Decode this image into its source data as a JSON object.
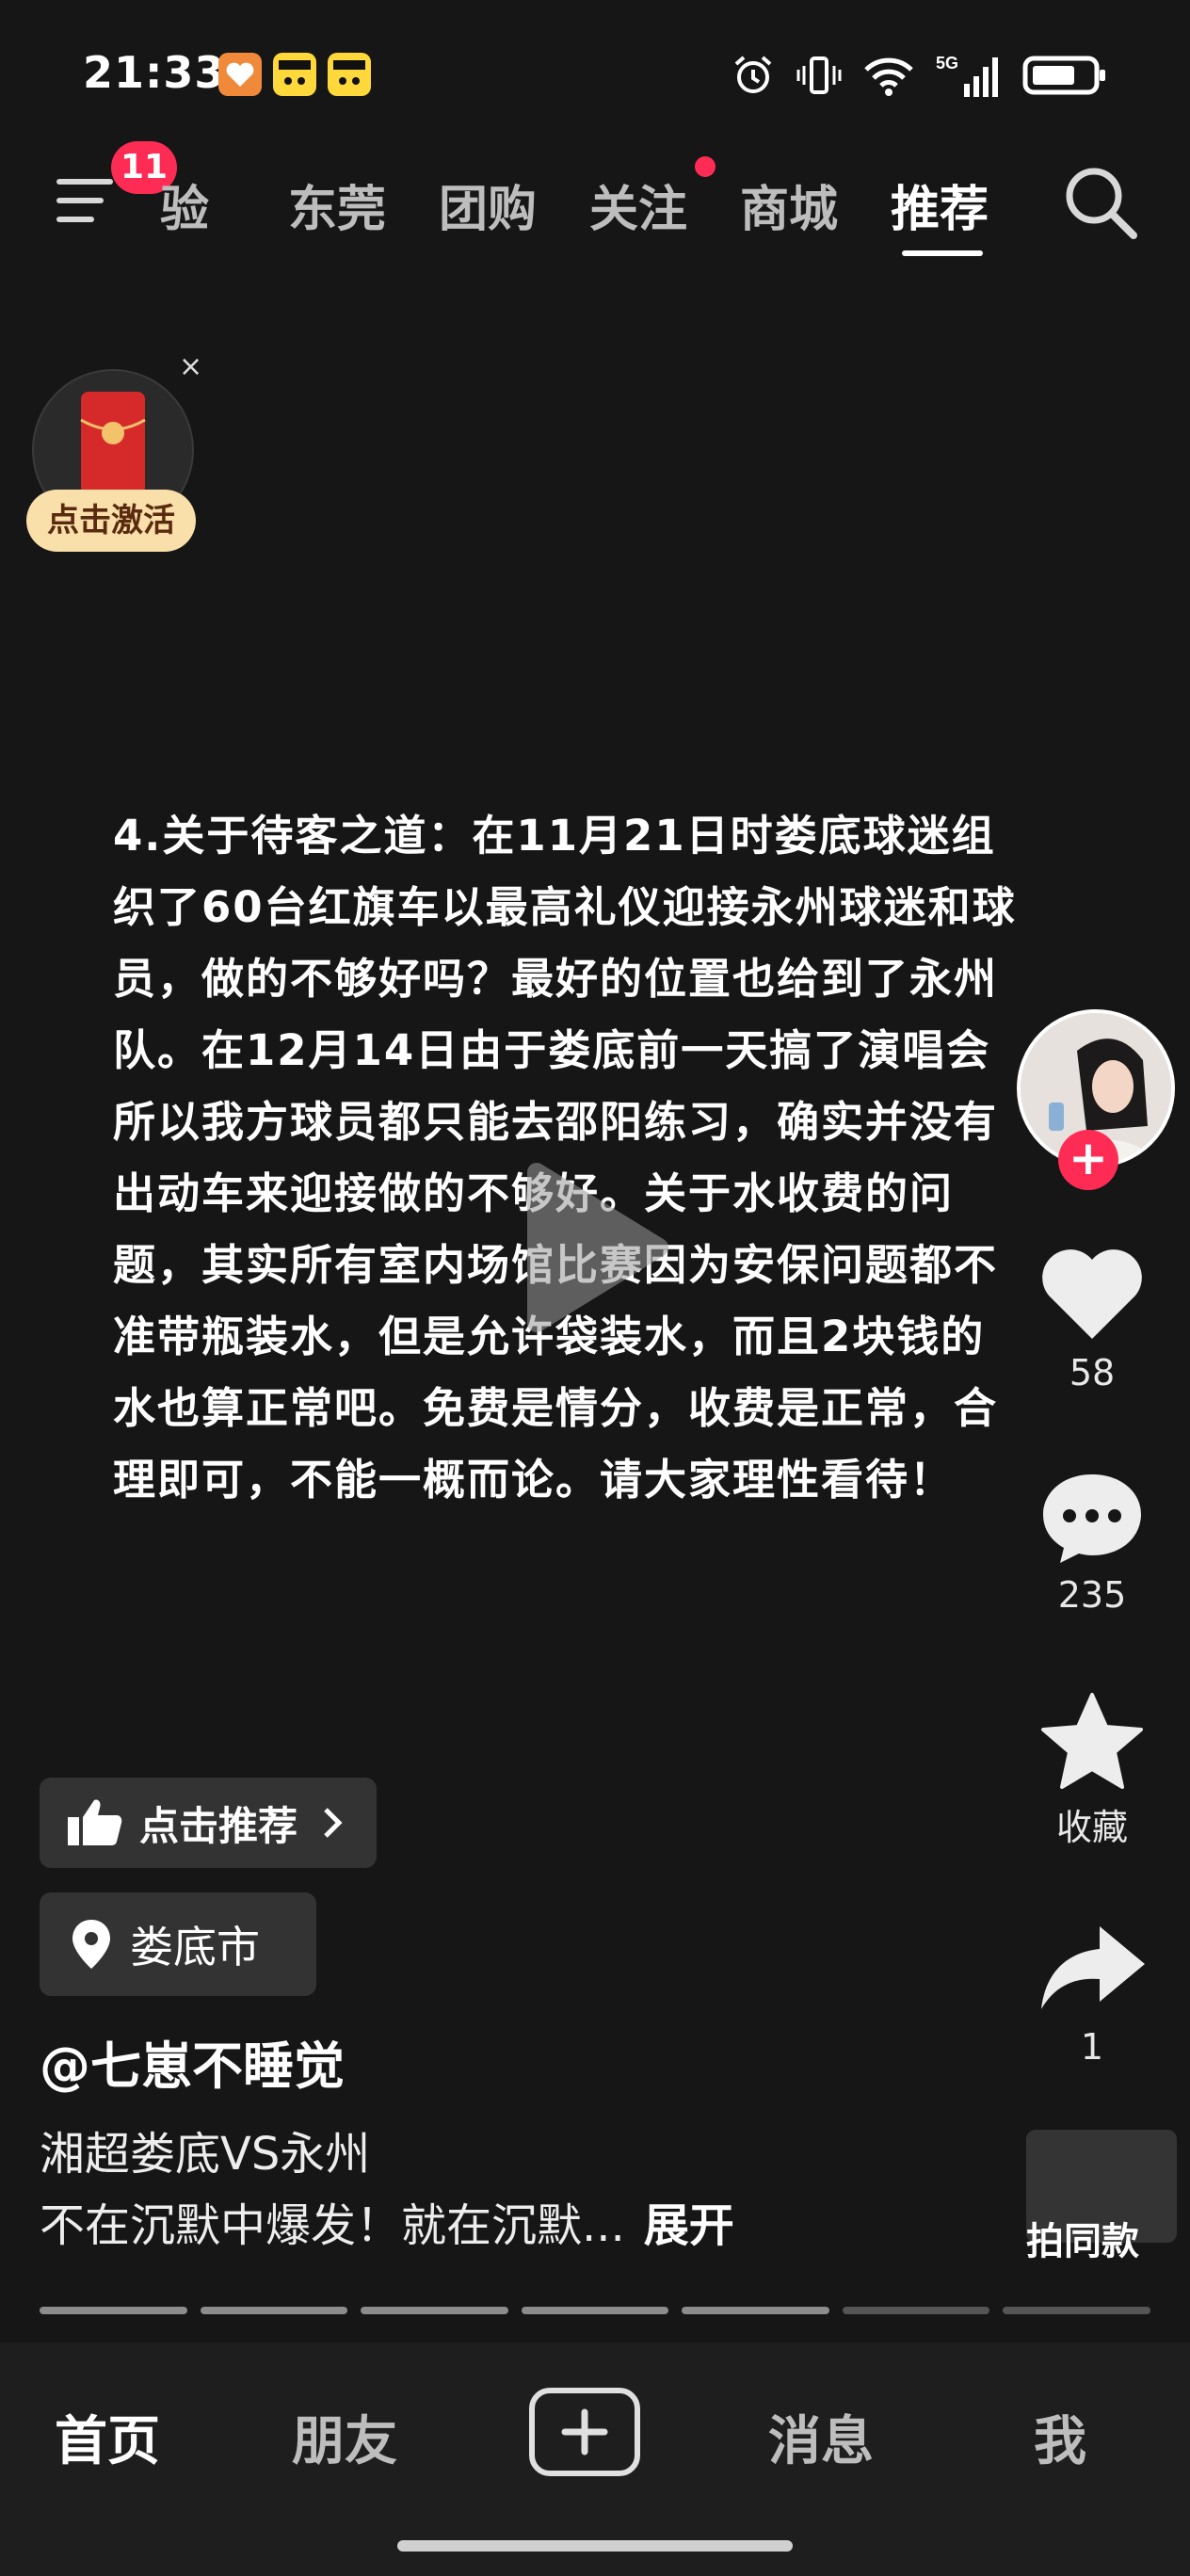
{
  "status_bar": {
    "time": "21:33",
    "app_icons": [
      "heart-app-icon",
      "emoji-app-icon",
      "emoji-app-icon"
    ],
    "status_icons": [
      "alarm-icon",
      "vibrate-icon",
      "wifi-icon",
      "signal-5g-icon",
      "battery-icon"
    ]
  },
  "top_nav": {
    "menu_badge": "11",
    "tabs": [
      {
        "label": "经验",
        "display": "验"
      },
      {
        "label": "东莞"
      },
      {
        "label": "团购"
      },
      {
        "label": "关注"
      },
      {
        "label": "商城"
      },
      {
        "label": "推荐"
      }
    ],
    "active_tab": "推荐"
  },
  "widget": {
    "cta": "点击激活",
    "close": "×"
  },
  "caption": "4.关于待客之道：在11月21日时娄底球迷组\n织了60台红旗车以最高礼仪迎接永州球迷和球\n员，做的不够好吗？最好的位置也给到了永州\n队。在12月14日由于娄底前一天搞了演唱会\n所以我方球员都只能去邵阳练习，确实并没有\n出动车来迎接做的不够好。关于水收费的问\n题，其实所有室内场馆比赛因为安保问题都不\n准带瓶装水，但是允许袋装水，而且2块钱的\n水也算正常吧。免费是情分，收费是正常，合\n理即可，不能一概而论。请大家理性看待！",
  "side_actions": {
    "likes": "58",
    "comments": "235",
    "favorite_label": "收藏",
    "shares": "1",
    "same_style_label": "拍同款"
  },
  "info": {
    "recommend_label": "点击推荐",
    "location": "娄底市",
    "author": "@七崽不睡觉",
    "desc_line1": "湘超娄底VS永州",
    "desc_line2": "不在沉默中爆发！就在沉默...",
    "expand_label": "展开"
  },
  "progress": {
    "total": 7,
    "completed": 5
  },
  "bottom_nav": {
    "home": "首页",
    "friends": "朋友",
    "messages": "消息",
    "me": "我"
  }
}
